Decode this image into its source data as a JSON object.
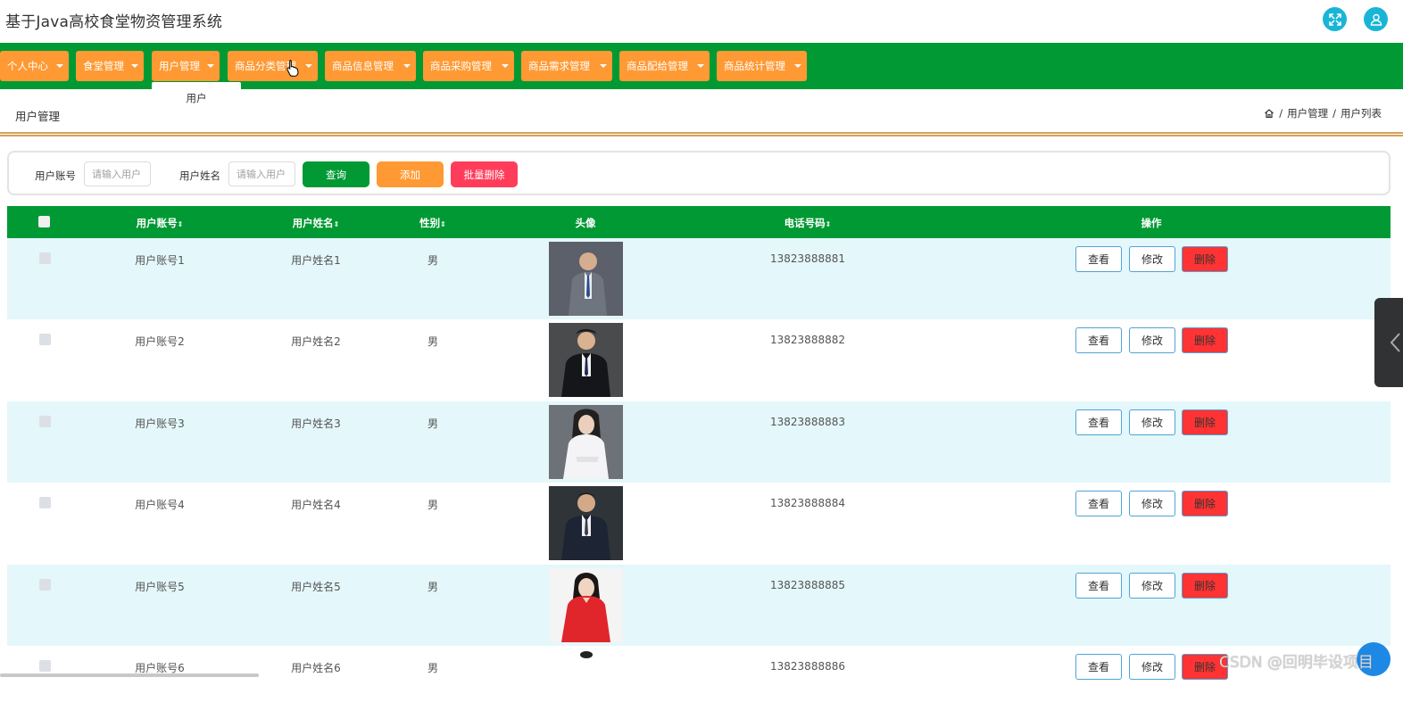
{
  "app": {
    "title": "基于Java高校食堂物资管理系统"
  },
  "topbar": {
    "fullscreen_icon": "expand-icon",
    "user_icon": "user-icon"
  },
  "nav": {
    "items": [
      {
        "label": "个人中心"
      },
      {
        "label": "食堂管理"
      },
      {
        "label": "用户管理"
      },
      {
        "label": "商品分类管理"
      },
      {
        "label": "商品信息管理"
      },
      {
        "label": "商品采购管理"
      },
      {
        "label": "商品需求管理"
      },
      {
        "label": "商品配给管理"
      },
      {
        "label": "商品统计管理"
      }
    ],
    "dropdown_item": "用户"
  },
  "page": {
    "title": "用户管理",
    "breadcrumb": {
      "sep1": "/",
      "level1": "用户管理",
      "sep2": "/",
      "level2": "用户列表"
    }
  },
  "search": {
    "account_label": "用户账号",
    "account_placeholder": "请输入用户",
    "name_label": "用户姓名",
    "name_placeholder": "请输入用户",
    "query_label": "查询",
    "add_label": "添加",
    "batch_delete_label": "批量删除"
  },
  "colors": {
    "primary": "#009933",
    "accent": "#ff9933",
    "danger": "#ff3333",
    "row_alt": "#e4f7fa"
  },
  "table": {
    "headers": {
      "account": "用户账号",
      "name": "用户姓名",
      "gender": "性别",
      "avatar": "头像",
      "phone": "电话号码",
      "actions": "操作"
    },
    "sort_mark": "⇕",
    "actions": {
      "view": "查看",
      "edit": "修改",
      "delete": "删除"
    },
    "rows": [
      {
        "account": "用户账号1",
        "name": "用户姓名1",
        "gender": "男",
        "phone": "13823888881"
      },
      {
        "account": "用户账号2",
        "name": "用户姓名2",
        "gender": "男",
        "phone": "13823888882"
      },
      {
        "account": "用户账号3",
        "name": "用户姓名3",
        "gender": "男",
        "phone": "13823888883"
      },
      {
        "account": "用户账号4",
        "name": "用户姓名4",
        "gender": "男",
        "phone": "13823888884"
      },
      {
        "account": "用户账号5",
        "name": "用户姓名5",
        "gender": "男",
        "phone": "13823888885"
      },
      {
        "account": "用户账号6",
        "name": "用户姓名6",
        "gender": "男",
        "phone": "13823888886"
      }
    ]
  },
  "watermark": "CSDN @回明毕设项目"
}
